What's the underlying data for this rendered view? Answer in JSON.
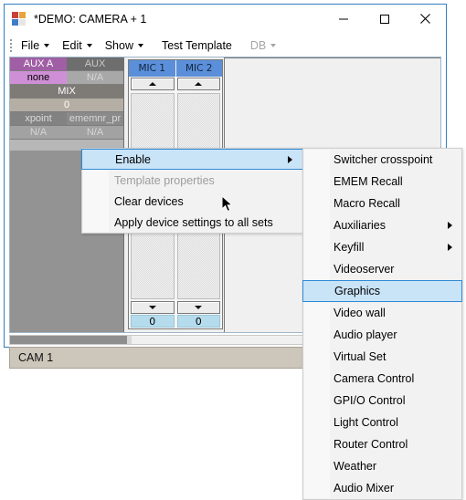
{
  "window": {
    "title": "*DEMO: CAMERA + 1",
    "icon": "app-squares-icon",
    "controls": {
      "minimize": "minimize-icon",
      "maximize": "maximize-icon",
      "close": "close-icon"
    }
  },
  "menubar": {
    "items": [
      {
        "label": "File",
        "has_caret": true,
        "disabled": false
      },
      {
        "label": "Edit",
        "has_caret": true,
        "disabled": false
      },
      {
        "label": "Show",
        "has_caret": true,
        "disabled": false
      },
      {
        "label": "Test Template",
        "has_caret": false,
        "disabled": false
      },
      {
        "label": "DB",
        "has_caret": true,
        "disabled": true
      }
    ]
  },
  "device_grid": {
    "rows": [
      {
        "left": "AUX A",
        "right": "AUX"
      },
      {
        "left": "none",
        "right": "N/A"
      },
      {
        "full": "MIX"
      },
      {
        "full": "0"
      },
      {
        "left": "xpoint",
        "right": "ememnr_pr"
      },
      {
        "left": "N/A",
        "right": "N/A"
      }
    ]
  },
  "mic_panel": {
    "channels": [
      {
        "label": "MIC 1",
        "value": "0",
        "up": "spin-up-icon",
        "down": "spin-down-icon"
      },
      {
        "label": "MIC 2",
        "value": "0",
        "up": "spin-up-icon",
        "down": "spin-down-icon"
      }
    ]
  },
  "status_bar": {
    "name": "CAM 1"
  },
  "context_menu": {
    "items": [
      {
        "label": "Enable",
        "disabled": false,
        "selected": true,
        "submenu": true
      },
      {
        "label": "Template properties",
        "disabled": true,
        "selected": false,
        "submenu": false
      },
      {
        "label": "Clear devices",
        "disabled": false,
        "selected": false,
        "submenu": false
      },
      {
        "label": "Apply device settings to all sets",
        "disabled": false,
        "selected": false,
        "submenu": false
      }
    ]
  },
  "submenu": {
    "items": [
      {
        "label": "Switcher crosspoint",
        "selected": false,
        "submenu": false
      },
      {
        "label": "EMEM Recall",
        "selected": false,
        "submenu": false
      },
      {
        "label": "Macro Recall",
        "selected": false,
        "submenu": false
      },
      {
        "label": "Auxiliaries",
        "selected": false,
        "submenu": true
      },
      {
        "label": "Keyfill",
        "selected": false,
        "submenu": true
      },
      {
        "label": "Videoserver",
        "selected": false,
        "submenu": false
      },
      {
        "label": "Graphics",
        "selected": true,
        "submenu": false
      },
      {
        "label": "Video wall",
        "selected": false,
        "submenu": false
      },
      {
        "label": "Audio player",
        "selected": false,
        "submenu": false
      },
      {
        "label": "Virtual Set",
        "selected": false,
        "submenu": false
      },
      {
        "label": "Camera Control",
        "selected": false,
        "submenu": false
      },
      {
        "label": "GPI/O Control",
        "selected": false,
        "submenu": false
      },
      {
        "label": "Light Control",
        "selected": false,
        "submenu": false
      },
      {
        "label": "Router Control",
        "selected": false,
        "submenu": false
      },
      {
        "label": "Weather",
        "selected": false,
        "submenu": false
      },
      {
        "label": "Audio Mixer",
        "selected": false,
        "submenu": false
      }
    ]
  },
  "colors": {
    "window_border": "#2f7fc1",
    "selection": "#c9e3f7",
    "selection_border": "#2f8ad4",
    "aux_a": "#a05fa5",
    "aux_none": "#cf8fd6",
    "mic_header": "#5b8fd9",
    "mic_value": "#b5dced",
    "status_bar": "#cdc6bb",
    "device_grid": "#8e8e8e"
  }
}
